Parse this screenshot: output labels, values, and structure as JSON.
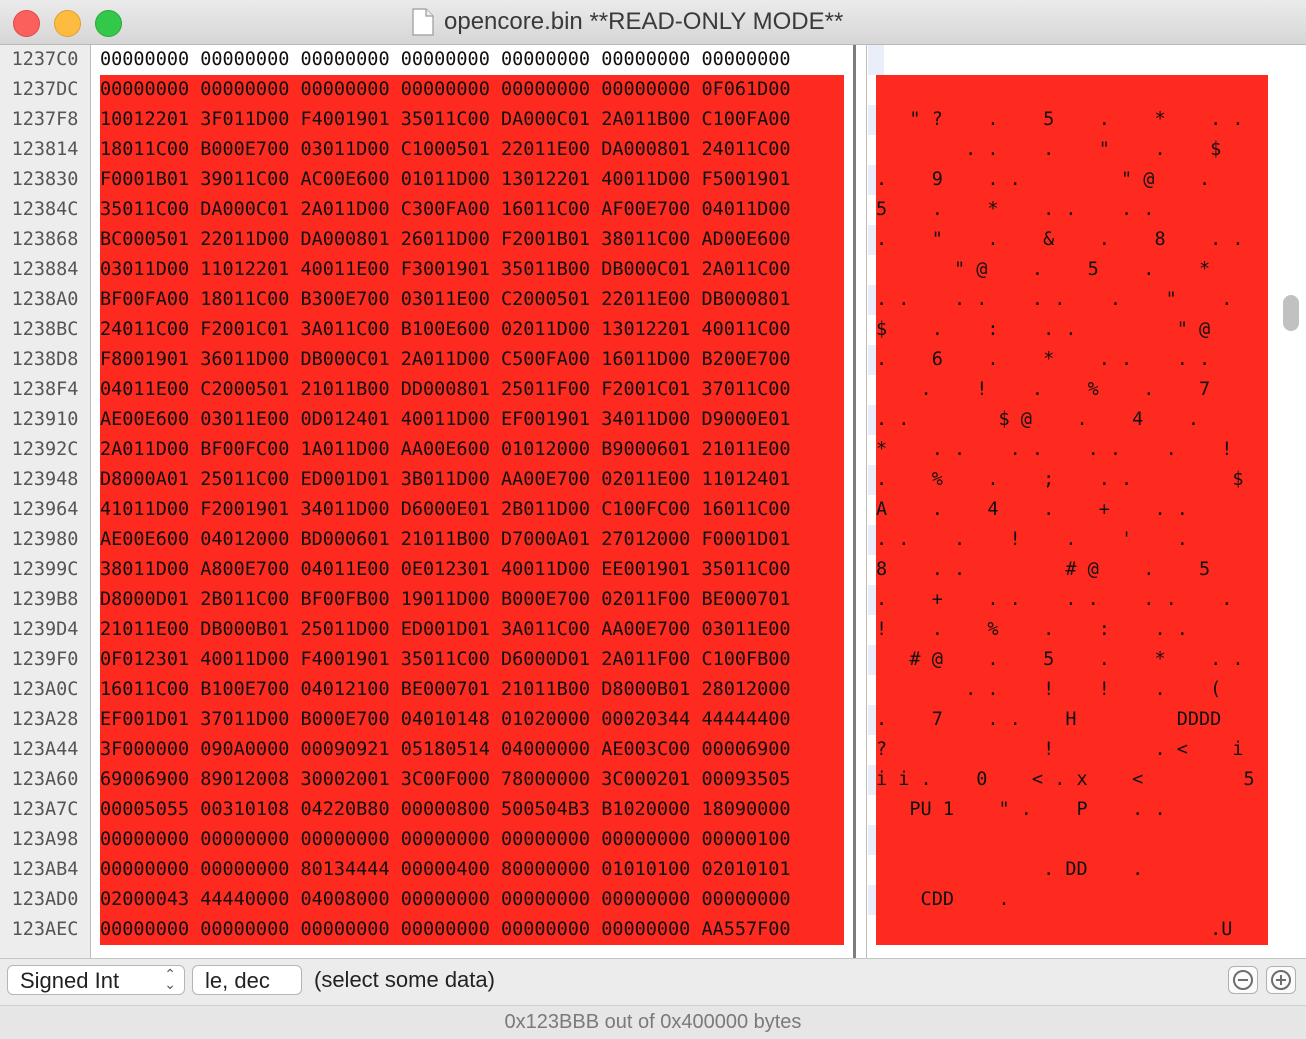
{
  "window": {
    "title": "opencore.bin **READ-ONLY MODE**"
  },
  "colors": {
    "selection": "#ff2a1f",
    "stripe": "#e9eef8"
  },
  "rows": [
    {
      "offset": "1237C0",
      "hex": "00000000 00000000 00000000 00000000 00000000 00000000 00000000",
      "ascii": "",
      "selected": false
    },
    {
      "offset": "1237DC",
      "hex": "00000000 00000000 00000000 00000000 00000000 00000000 0F061D00",
      "ascii": "",
      "selected": true
    },
    {
      "offset": "1237F8",
      "hex": "10012201 3F011D00 F4001901 35011C00 DA000C01 2A011B00 C100FA00",
      "ascii": "   \" ?    .    5    .    *    . .",
      "selected": true
    },
    {
      "offset": "123814",
      "hex": "18011C00 B000E700 03011D00 C1000501 22011E00 DA000801 24011C00",
      "ascii": "        . .    .    \"    .    $",
      "selected": true
    },
    {
      "offset": "123830",
      "hex": "F0001B01 39011C00 AC00E600 01011D00 13012201 40011D00 F5001901",
      "ascii": ".    9    . .         \" @    .",
      "selected": true
    },
    {
      "offset": "12384C",
      "hex": "35011C00 DA000C01 2A011D00 C300FA00 16011C00 AF00E700 04011D00",
      "ascii": "5    .    *    . .    . .",
      "selected": true
    },
    {
      "offset": "123868",
      "hex": "BC000501 22011D00 DA000801 26011D00 F2001B01 38011C00 AD00E600",
      "ascii": ".    \"    .    &    .    8    . .",
      "selected": true
    },
    {
      "offset": "123884",
      "hex": "03011D00 11012201 40011E00 F3001901 35011B00 DB000C01 2A011C00",
      "ascii": "       \" @    .    5    .    *",
      "selected": true
    },
    {
      "offset": "1238A0",
      "hex": "BF00FA00 18011C00 B300E700 03011E00 C2000501 22011E00 DB000801",
      "ascii": ". .    . .    . .    .    \"    .",
      "selected": true
    },
    {
      "offset": "1238BC",
      "hex": "24011C00 F2001C01 3A011C00 B100E600 02011D00 13012201 40011C00",
      "ascii": "$    .    :    . .         \" @",
      "selected": true
    },
    {
      "offset": "1238D8",
      "hex": "F8001901 36011D00 DB000C01 2A011D00 C500FA00 16011D00 B200E700",
      "ascii": ".    6    .    *    . .    . .",
      "selected": true
    },
    {
      "offset": "1238F4",
      "hex": "04011E00 C2000501 21011B00 DD000801 25011F00 F2001C01 37011C00",
      "ascii": "    .    !    .    %    .    7",
      "selected": true
    },
    {
      "offset": "123910",
      "hex": "AE00E600 03011E00 0D012401 40011D00 EF001901 34011D00 D9000E01",
      "ascii": ". .        $ @    .    4    .",
      "selected": true
    },
    {
      "offset": "12392C",
      "hex": "2A011D00 BF00FC00 1A011D00 AA00E600 01012000 B9000601 21011E00",
      "ascii": "*    . .    . .    . .    .    !",
      "selected": true
    },
    {
      "offset": "123948",
      "hex": "D8000A01 25011C00 ED001D01 3B011D00 AA00E700 02011E00 11012401",
      "ascii": ".    %    .    ;    . .         $",
      "selected": true
    },
    {
      "offset": "123964",
      "hex": "41011D00 F2001901 34011D00 D6000E01 2B011D00 C100FC00 16011C00",
      "ascii": "A    .    4    .    +    . .",
      "selected": true
    },
    {
      "offset": "123980",
      "hex": "AE00E600 04012000 BD000601 21011B00 D7000A01 27012000 F0001D01",
      "ascii": ". .    .    !    .    '    .",
      "selected": true
    },
    {
      "offset": "12399C",
      "hex": "38011D00 A800E700 04011E00 0E012301 40011D00 EE001901 35011C00",
      "ascii": "8    . .         # @    .    5",
      "selected": true
    },
    {
      "offset": "1239B8",
      "hex": "D8000D01 2B011C00 BF00FB00 19011D00 B000E700 02011F00 BE000701",
      "ascii": ".    +    . .    . .    . .    .",
      "selected": true
    },
    {
      "offset": "1239D4",
      "hex": "21011E00 DB000B01 25011D00 ED001D01 3A011C00 AA00E700 03011E00",
      "ascii": "!    .    %    .    :    . .",
      "selected": true
    },
    {
      "offset": "1239F0",
      "hex": "0F012301 40011D00 F4001901 35011C00 D6000D01 2A011F00 C100FB00",
      "ascii": "   # @    .    5    .    *    . .",
      "selected": true
    },
    {
      "offset": "123A0C",
      "hex": "16011C00 B100E700 04012100 BE000701 21011B00 D8000B01 28012000",
      "ascii": "        . .    !    !    .    (",
      "selected": true
    },
    {
      "offset": "123A28",
      "hex": "EF001D01 37011D00 B000E700 04010148 01020000 00020344 44444400",
      "ascii": ".    7    . .    H         DDDD",
      "selected": true
    },
    {
      "offset": "123A44",
      "hex": "3F000000 090A0000 00090921 05180514 04000000 AE003C00 00006900",
      "ascii": "?              !         . <    i",
      "selected": true
    },
    {
      "offset": "123A60",
      "hex": "69006900 89012008 30002001 3C00F000 78000000 3C000201 00093505",
      "ascii": "i i .    0    < . x    <         5",
      "selected": true
    },
    {
      "offset": "123A7C",
      "hex": "00005055 00310108 04220B80 00000800 500504B3 B1020000 18090000",
      "ascii": "   PU 1    \" .    P    . .",
      "selected": true
    },
    {
      "offset": "123A98",
      "hex": "00000000 00000000 00000000 00000000 00000000 00000000 00000100",
      "ascii": "",
      "selected": true
    },
    {
      "offset": "123AB4",
      "hex": "00000000 00000000 80134444 00000400 80000000 01010100 02010101",
      "ascii": "               . DD    .",
      "selected": true
    },
    {
      "offset": "123AD0",
      "hex": "02000043 44440000 04008000 00000000 00000000 00000000 00000000",
      "ascii": "    CDD    .",
      "selected": true
    },
    {
      "offset": "123AEC",
      "hex": "00000000 00000000 00000000 00000000 00000000 00000000 AA557F00",
      "ascii": "                              .U",
      "selected": true
    }
  ],
  "toolbar": {
    "type_label": "Signed Int",
    "format_label": "le, dec",
    "hint": "(select some data)",
    "remove_icon": "minus-circle-icon",
    "add_icon": "plus-circle-icon"
  },
  "status": {
    "text": "0x123BBB out of 0x400000 bytes"
  }
}
